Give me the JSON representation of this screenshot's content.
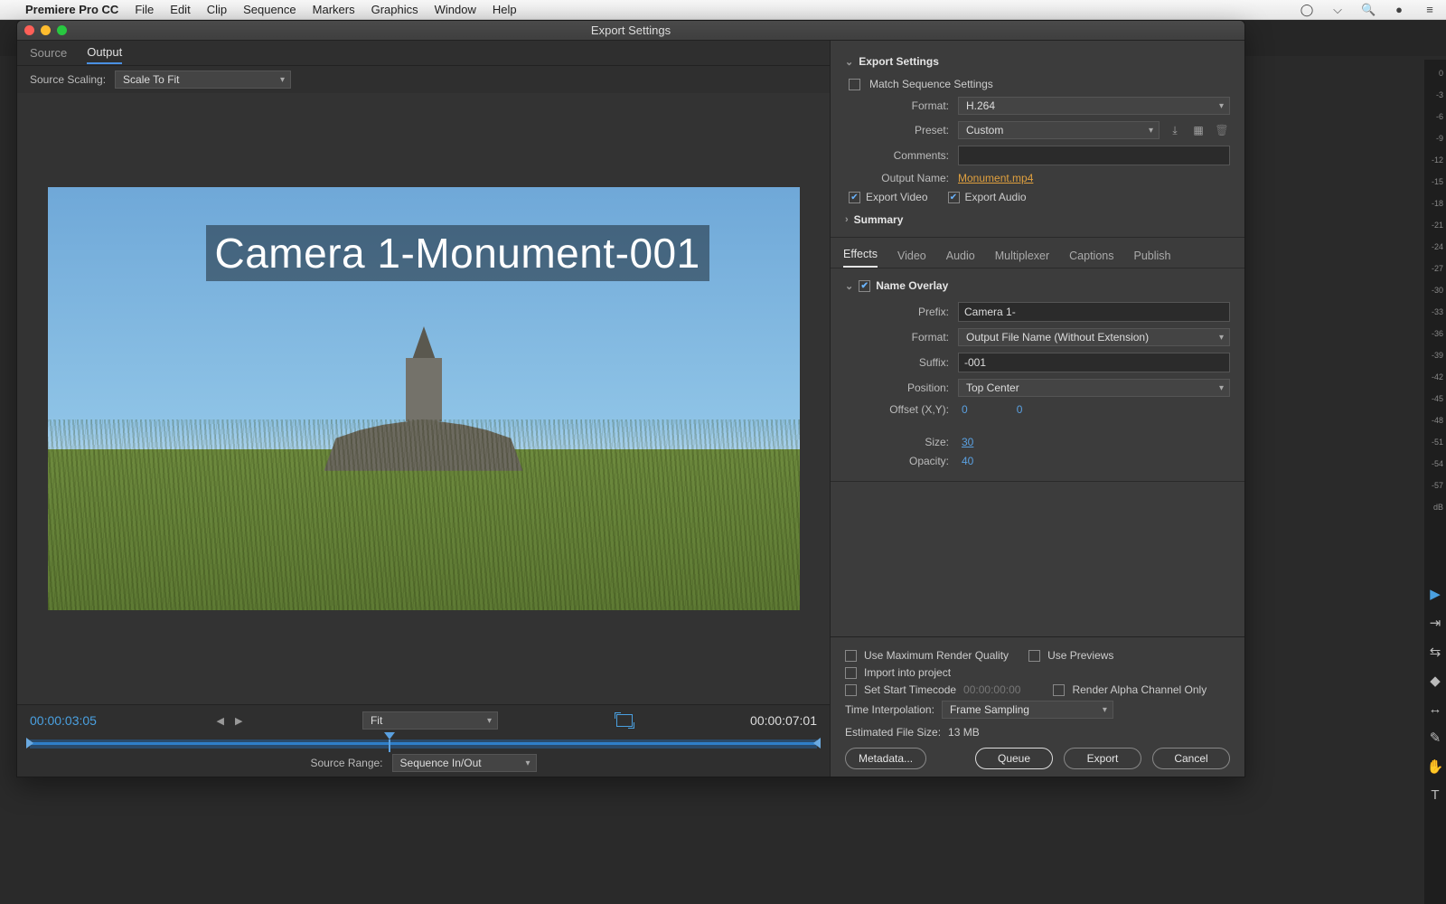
{
  "menubar": {
    "app": "Premiere Pro CC",
    "items": [
      "File",
      "Edit",
      "Clip",
      "Sequence",
      "Markers",
      "Graphics",
      "Window",
      "Help"
    ]
  },
  "window": {
    "title": "Export Settings"
  },
  "left": {
    "tabs": {
      "source": "Source",
      "output": "Output"
    },
    "scaling_label": "Source Scaling:",
    "scaling_value": "Scale To Fit",
    "overlay_text": "Camera 1-Monument-001",
    "tc_in": "00:00:03:05",
    "tc_out": "00:00:07:01",
    "fit": "Fit",
    "source_range_label": "Source Range:",
    "source_range_value": "Sequence In/Out"
  },
  "export": {
    "header": "Export Settings",
    "match_label": "Match Sequence Settings",
    "format_label": "Format:",
    "format_value": "H.264",
    "preset_label": "Preset:",
    "preset_value": "Custom",
    "comments_label": "Comments:",
    "output_name_label": "Output Name:",
    "output_name_value": "Monument.mp4",
    "export_video": "Export Video",
    "export_audio": "Export Audio",
    "summary": "Summary"
  },
  "subtabs": [
    "Effects",
    "Video",
    "Audio",
    "Multiplexer",
    "Captions",
    "Publish"
  ],
  "nameoverlay": {
    "header": "Name Overlay",
    "prefix_label": "Prefix:",
    "prefix_value": "Camera 1-",
    "format_label": "Format:",
    "format_value": "Output File Name (Without Extension)",
    "suffix_label": "Suffix:",
    "suffix_value": "-001",
    "position_label": "Position:",
    "position_value": "Top Center",
    "offset_label": "Offset (X,Y):",
    "offset_x": "0",
    "offset_y": "0",
    "size_label": "Size:",
    "size_value": "30",
    "opacity_label": "Opacity:",
    "opacity_value": "40"
  },
  "bottom": {
    "max_render": "Use Maximum Render Quality",
    "use_previews": "Use Previews",
    "import": "Import into project",
    "set_tc": "Set Start Timecode",
    "set_tc_val": "00:00:00:00",
    "alpha": "Render Alpha Channel Only",
    "time_interp_label": "Time Interpolation:",
    "time_interp_value": "Frame Sampling",
    "est_label": "Estimated File Size:",
    "est_value": "13 MB",
    "metadata_btn": "Metadata...",
    "queue_btn": "Queue",
    "export_btn": "Export",
    "cancel_btn": "Cancel"
  },
  "db_ticks": [
    "0",
    "-3",
    "-6",
    "-9",
    "-12",
    "-15",
    "-18",
    "-21",
    "-24",
    "-27",
    "-30",
    "-33",
    "-36",
    "-39",
    "-42",
    "-45",
    "-48",
    "-51",
    "-54",
    "-57",
    "dB"
  ]
}
